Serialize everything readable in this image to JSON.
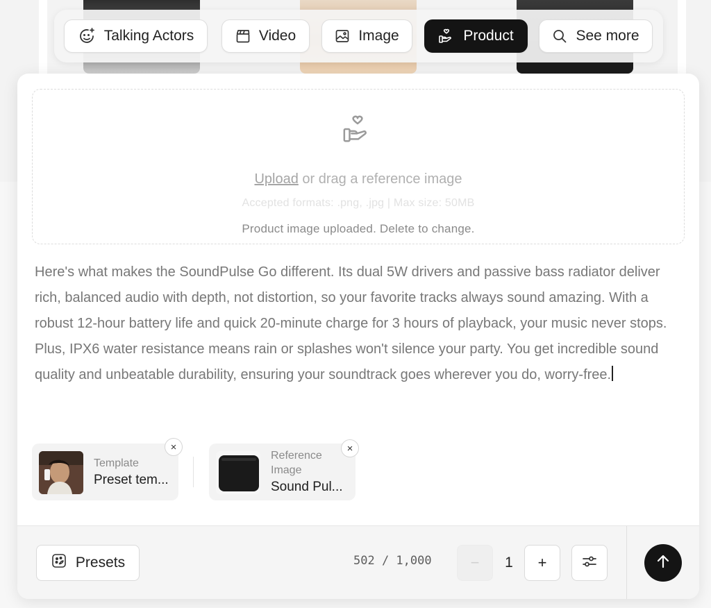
{
  "categories": [
    {
      "label": "Talking Actors",
      "icon": "face-sparkle-icon",
      "active": false
    },
    {
      "label": "Video",
      "icon": "clapperboard-icon",
      "active": false
    },
    {
      "label": "Image",
      "icon": "image-icon",
      "active": false
    },
    {
      "label": "Product",
      "icon": "hand-heart-icon",
      "active": true
    },
    {
      "label": "See more",
      "icon": "search-icon",
      "active": false
    }
  ],
  "upload": {
    "icon": "hand-heart-icon",
    "link_text": "Upload",
    "rest_text": " or drag a reference image",
    "formats": "Accepted formats: .png, .jpg | Max size: 50MB",
    "status": "Product image uploaded. Delete to change."
  },
  "script": {
    "text": "Here's what makes the SoundPulse Go different. Its dual 5W drivers and passive bass radiator deliver rich, balanced audio with depth, not distortion, so your favorite tracks always sound amazing. With a robust 12-hour battery life and quick 20-minute charge for 3 hours of playback, your music never stops. Plus, IPX6 water resistance means rain or splashes won't silence your party. You get incredible sound quality and unbeatable durability, ensuring your soundtrack goes wherever you do, worry-free."
  },
  "attachments": [
    {
      "label": "Template",
      "value": "Preset tem...",
      "close": "×"
    },
    {
      "label": "Reference Image",
      "value": "Sound Pul...",
      "close": "×"
    }
  ],
  "footer": {
    "presets_label": "Presets",
    "char_count": "502 / 1,000",
    "quantity": "1",
    "decrement": "−",
    "increment": "+"
  },
  "colors": {
    "active_tab": "#141414",
    "send_button": "#141414",
    "card_bg": "#ffffff"
  }
}
